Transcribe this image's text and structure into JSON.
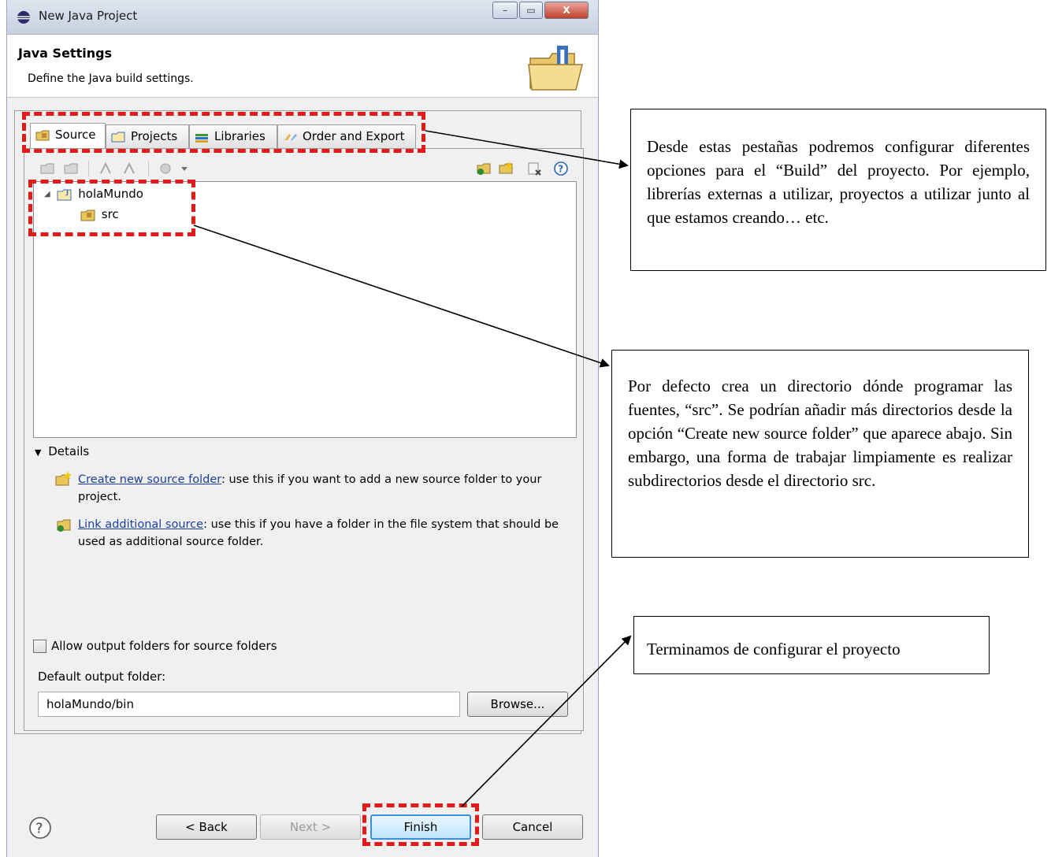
{
  "window": {
    "title": "New Java Project",
    "controls": {
      "minimize": "–",
      "maximize": "▭",
      "close": "X"
    }
  },
  "header": {
    "title": "Java Settings",
    "description": "Define the Java build settings."
  },
  "tabs": [
    {
      "label": "Source",
      "icon": "source-folder-icon",
      "active": true
    },
    {
      "label": "Projects",
      "icon": "projects-icon",
      "active": false
    },
    {
      "label": "Libraries",
      "icon": "libraries-icon",
      "active": false
    },
    {
      "label": "Order and Export",
      "icon": "order-export-icon",
      "active": false
    }
  ],
  "tree": {
    "project": "holaMundo",
    "folder": "src"
  },
  "details": {
    "toggle_label": "Details",
    "create_link": "Create new source folder",
    "create_text": ": use this if you want to add a new source folder to your project.",
    "link_link": "Link additional source",
    "link_text": ": use this if you have a folder in the file system that should be used as additional source folder."
  },
  "output": {
    "checkbox_label": "Allow output folders for source folders",
    "default_label": "Default output folder:",
    "default_value": "holaMundo/bin",
    "browse_label": "Browse..."
  },
  "footer": {
    "back_label": "< Back",
    "next_label": "Next >",
    "finish_label": "Finish",
    "cancel_label": "Cancel"
  },
  "annotations": {
    "tabs_note": "Desde estas pestañas podremos configurar diferentes opciones para el “Build” del proyecto. Por ejemplo, librerías externas a utilizar, proyectos a utilizar junto al que estamos creando… etc.",
    "src_note": "Por defecto crea un directorio dónde programar las fuentes, “src”. Se podrían añadir más directorios desde la opción “Create new source folder” que aparece abajo. Sin embargo, una forma de trabajar limpiamente es realizar subdirectorios desde el directorio src.",
    "finish_note": "Terminamos de configurar el proyecto"
  },
  "colors": {
    "highlight_dashes": "#e11a1a",
    "link": "#1a3fa0",
    "finish_border": "#3c8fd6"
  }
}
